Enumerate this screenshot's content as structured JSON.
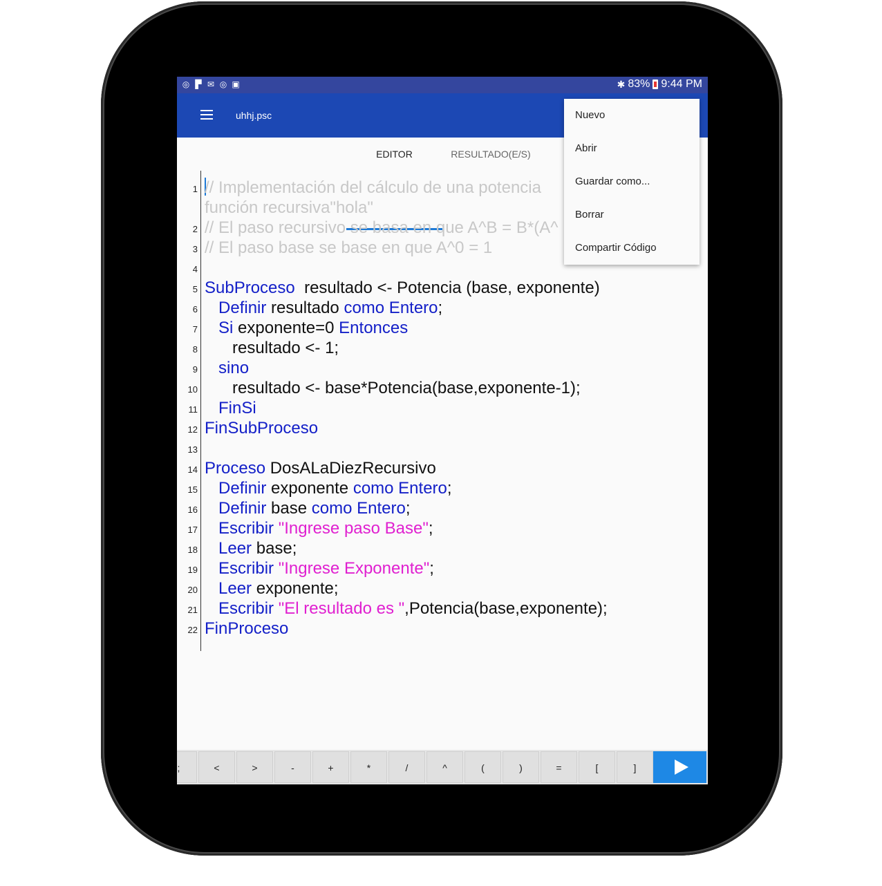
{
  "status_bar": {
    "battery": "83%",
    "time": "9:44 PM",
    "notification_icons": [
      "notification-icon",
      "flipboard-icon",
      "gmail-icon",
      "notification-icon",
      "briefcase-icon"
    ]
  },
  "app_bar": {
    "title": "uhhj.psc"
  },
  "tabs": [
    {
      "label": "EDITOR",
      "active": true
    },
    {
      "label": "RESULTADO(E/S)",
      "active": false
    }
  ],
  "menu": {
    "items": [
      {
        "label": "Nuevo"
      },
      {
        "label": "Abrir"
      },
      {
        "label": "Guardar como..."
      },
      {
        "label": "Borrar"
      },
      {
        "label": "Compartir Código"
      }
    ]
  },
  "code_lines": [
    {
      "n": "1",
      "parts": [
        [
          "cm",
          "// Implementación del cálculo de una potencia"
        ]
      ]
    },
    {
      "n": "",
      "parts": [
        [
          "cm",
          "función recursiva\"hola\""
        ]
      ]
    },
    {
      "n": "2",
      "parts": [
        [
          "cm",
          "// El paso recursivo se basa en que A^B = B*(A^"
        ]
      ]
    },
    {
      "n": "3",
      "parts": [
        [
          "cm",
          "// El paso base se base en que A^0 = 1"
        ]
      ]
    },
    {
      "n": "4",
      "parts": []
    },
    {
      "n": "5",
      "parts": [
        [
          "kw",
          "SubProceso"
        ],
        [
          "tx",
          "  resultado <- Potencia (base, exponente)"
        ]
      ]
    },
    {
      "n": "6",
      "parts": [
        [
          "tx",
          "   "
        ],
        [
          "kw",
          "Definir"
        ],
        [
          "tx",
          " resultado "
        ],
        [
          "kw",
          "como Entero"
        ],
        [
          "tx",
          ";"
        ]
      ]
    },
    {
      "n": "7",
      "parts": [
        [
          "tx",
          "   "
        ],
        [
          "kw",
          "Si"
        ],
        [
          "tx",
          " exponente=0 "
        ],
        [
          "kw",
          "Entonces"
        ]
      ]
    },
    {
      "n": "8",
      "parts": [
        [
          "tx",
          "      resultado <- 1;"
        ]
      ]
    },
    {
      "n": "9",
      "parts": [
        [
          "tx",
          "   "
        ],
        [
          "kw",
          "sino"
        ]
      ]
    },
    {
      "n": "10",
      "parts": [
        [
          "tx",
          "      resultado <- base*Potencia(base,exponente-1);"
        ]
      ]
    },
    {
      "n": "11",
      "parts": [
        [
          "tx",
          "   "
        ],
        [
          "kw",
          "FinSi"
        ]
      ]
    },
    {
      "n": "12",
      "parts": [
        [
          "kw",
          "FinSubProceso"
        ]
      ]
    },
    {
      "n": "13",
      "parts": []
    },
    {
      "n": "14",
      "parts": [
        [
          "kw",
          "Proceso"
        ],
        [
          "tx",
          " DosALaDiezRecursivo"
        ]
      ]
    },
    {
      "n": "15",
      "parts": [
        [
          "tx",
          "   "
        ],
        [
          "kw",
          "Definir"
        ],
        [
          "tx",
          " exponente "
        ],
        [
          "kw",
          "como Entero"
        ],
        [
          "tx",
          ";"
        ]
      ]
    },
    {
      "n": "16",
      "parts": [
        [
          "tx",
          "   "
        ],
        [
          "kw",
          "Definir"
        ],
        [
          "tx",
          " base "
        ],
        [
          "kw",
          "como Entero"
        ],
        [
          "tx",
          ";"
        ]
      ]
    },
    {
      "n": "17",
      "parts": [
        [
          "tx",
          "   "
        ],
        [
          "kw",
          "Escribir"
        ],
        [
          "tx",
          " "
        ],
        [
          "str",
          "\"Ingrese paso Base\""
        ],
        [
          "tx",
          ";"
        ]
      ]
    },
    {
      "n": "18",
      "parts": [
        [
          "tx",
          "   "
        ],
        [
          "kw",
          "Leer"
        ],
        [
          "tx",
          " base;"
        ]
      ]
    },
    {
      "n": "19",
      "parts": [
        [
          "tx",
          "   "
        ],
        [
          "kw",
          "Escribir"
        ],
        [
          "tx",
          " "
        ],
        [
          "str",
          "\"Ingrese Exponente\""
        ],
        [
          "tx",
          ";"
        ]
      ]
    },
    {
      "n": "20",
      "parts": [
        [
          "tx",
          "   "
        ],
        [
          "kw",
          "Leer"
        ],
        [
          "tx",
          " exponente;"
        ]
      ]
    },
    {
      "n": "21",
      "parts": [
        [
          "tx",
          "   "
        ],
        [
          "kw",
          "Escribir"
        ],
        [
          "tx",
          " "
        ],
        [
          "str",
          "\"El resultado es \""
        ],
        [
          "tx",
          ",Potencia(base,exponente);"
        ]
      ]
    },
    {
      "n": "22",
      "parts": [
        [
          "kw",
          "FinProceso"
        ]
      ]
    }
  ],
  "keys": [
    ";",
    "<",
    ">",
    "-",
    "+",
    "*",
    "/",
    "^",
    "(",
    ")",
    "=",
    "[",
    "]"
  ],
  "run_button": {
    "icon": "play-icon"
  }
}
